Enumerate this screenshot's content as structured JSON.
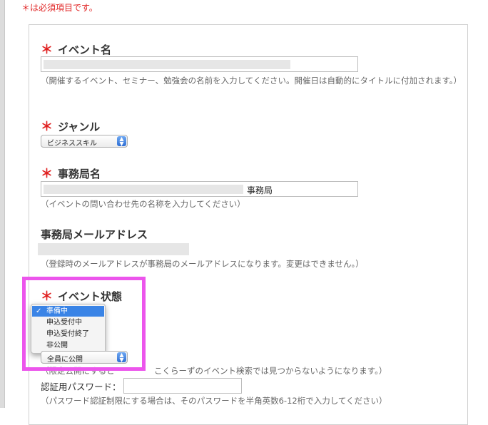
{
  "required_note": "＊は必須項目です。",
  "fields": {
    "event_name": {
      "label": "イベント名",
      "hint_line1": "（開催するイベント、セミナー、勉強会の名前を入力してください。開催日は自動的にタイトルに付加されます。）"
    },
    "genre": {
      "label": "ジャンル",
      "selected": "ビジネススキル"
    },
    "office_name": {
      "label": "事務局名",
      "suffix": "事務局",
      "hint": "（イベントの問い合わせ先の名称を入力してください）"
    },
    "office_email": {
      "label": "事務局メールアドレス",
      "hint": "（登録時のメールアドレスが事務局のメールアドレスになります。変更はできません。）"
    },
    "event_status": {
      "label": "イベント状態",
      "options": [
        "準備中",
        "申込受付中",
        "申込受付終了",
        "非公開"
      ],
      "selected": "準備中"
    },
    "visibility": {
      "selected": "全員に公開",
      "hint_prefix": "（限定公開にすると",
      "hint_suffix": "こくらーずのイベント検索では見つからないようになります。）"
    },
    "password": {
      "label": "認証用パスワード：",
      "hint": "（パスワード認証制限にする場合は、そのパスワードを半角英数6-12桁で入力してください）"
    }
  },
  "colors": {
    "required": "#e02020",
    "highlight": "#ec55ec",
    "selected_option": "#3a84e6"
  }
}
